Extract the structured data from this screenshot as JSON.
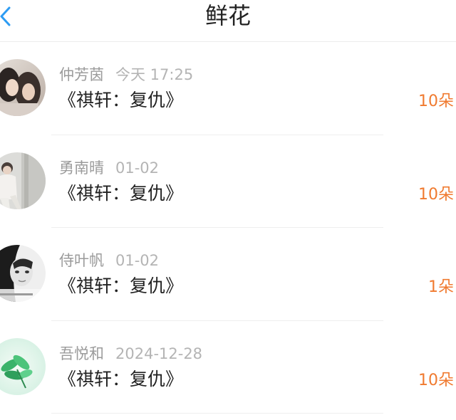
{
  "header": {
    "title": "鲜花",
    "back_icon": "chevron-left-icon",
    "accent_color": "#2d9cf3"
  },
  "items": [
    {
      "name": "仲芳茵",
      "time": "今天 17:25",
      "book": "《祺轩：复仇》",
      "count": "10朵",
      "avatar": "avatar-photo-two-people"
    },
    {
      "name": "勇南晴",
      "time": "01-02",
      "book": "《祺轩：复仇》",
      "count": "10朵",
      "avatar": "avatar-photo-person-in-white"
    },
    {
      "name": "侍叶帆",
      "time": "01-02",
      "book": "《祺轩：复仇》",
      "count": "1朵",
      "avatar": "avatar-photo-black-white-portrait"
    },
    {
      "name": "吾悦和",
      "time": "2024-12-28",
      "book": "《祺轩：复仇》",
      "count": "10朵",
      "avatar": "avatar-green-leaves"
    }
  ],
  "count_color": "#f07a2f"
}
